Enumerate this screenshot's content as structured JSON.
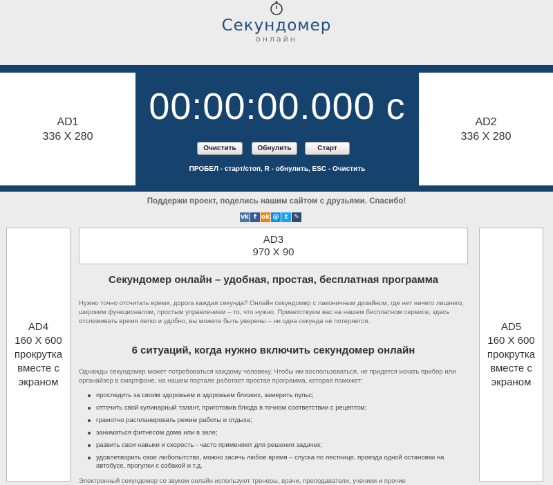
{
  "header": {
    "title": "Секундомер",
    "subtitle": "онлайн",
    "icon": "stopwatch-icon"
  },
  "timer": {
    "display": "00:00:00.000 с"
  },
  "buttons": {
    "clear": "Очистить",
    "reset": "Обнулить",
    "start": "Старт"
  },
  "hint": "ПРОБЕЛ - старт/стоп, R - обнулить, ESC - Очистить",
  "ads": {
    "ad1": {
      "name": "AD1",
      "size": "336 X 280"
    },
    "ad2": {
      "name": "AD2",
      "size": "336 X 280"
    },
    "ad3": {
      "name": "AD3",
      "size": "970 X 90"
    },
    "ad4": {
      "name": "AD4",
      "size": "160 X 600",
      "note1": "прокрутка",
      "note2": "вместе с",
      "note3": "экраном"
    },
    "ad5": {
      "name": "AD5",
      "size": "160 X 600",
      "note1": "прокрутка",
      "note2": "вместе с",
      "note3": "экраном"
    }
  },
  "share": {
    "text": "Поддержи проект, поделись нашим сайтом с друзьями. Спасибо!",
    "icons": [
      {
        "label": "vk",
        "name": "vk-icon",
        "color": "#4a76a8"
      },
      {
        "label": "f",
        "name": "facebook-icon",
        "color": "#3b5998"
      },
      {
        "label": "ok",
        "name": "odnoklassniki-icon",
        "color": "#ee8208"
      },
      {
        "label": "@",
        "name": "mailru-icon",
        "color": "#168de2"
      },
      {
        "label": "t",
        "name": "twitter-icon",
        "color": "#1da1f2"
      },
      {
        "label": "✎",
        "name": "livejournal-icon",
        "color": "#2f4c6a"
      }
    ]
  },
  "article": {
    "h1": "Секундомер онлайн – удобная, простая, бесплатная программа",
    "p1": "Нужно точно отсчитать время, дорога каждая секунда? Онлайн секундомер с лаконичным дизайном, где нет ничего лишнего, широким функционалом, простым управлением – то, что нужно. Приветствуем вас на нашем бесплатном сервисе, здесь отслеживать время легко и удобно, вы можете быть уверены – ни одна секунда не потеряется.",
    "h2": "6 ситуаций, когда нужно включить секундомер онлайн",
    "p2": "Однажды секундомер может потребоваться каждому человеку. Чтобы им воспользоваться, не придется искать прибор или органайзер в смартфоне, на нашем портале работает простая программа, которая поможет:",
    "items": [
      "проследить за своим здоровьем и здоровьем близких, замерить пульс;",
      "отточить свой кулинарный талант, приготовив блюда в точном соответствии с рецептом;",
      "грамотно распланировать режим работы и отдыха;",
      "заниматься фитнесом дома или в зале;",
      "развить свои навыки и скорость - часто применяют для решения задачек;",
      "удовлетворить свое любопытство, можно засечь любое время – спуска по лестнице, проезда одной остановки на автобусе, прогулки с собакой и т.д."
    ],
    "tail": "Электронный секундомер со звуком онлайн используют тренеры, врачи, преподаватели, ученики и прочие"
  }
}
